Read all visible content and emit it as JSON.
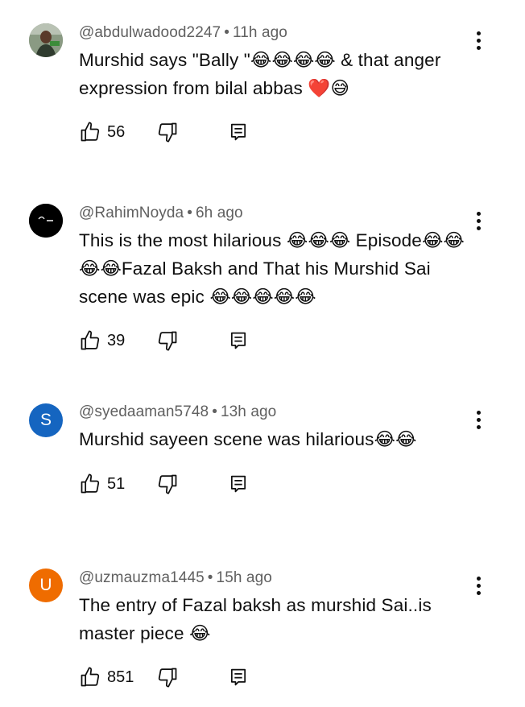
{
  "comments": [
    {
      "handle": "@abdulwadood2247",
      "time": "11h ago",
      "text": "Murshid says \"Bally \"😂😂😂😂 & that anger expression from bilal abbas ❤️😅",
      "likes": "56",
      "avatar": {
        "type": "photo",
        "color": "#6b7f63"
      }
    },
    {
      "handle": "@RahimNoyda",
      "time": "6h ago",
      "text": "This is the most hilarious 😂😂😂 Episode😂😂😂😂Fazal Baksh and That his Murshid Sai scene was epic 😂😂😂😂😂",
      "likes": "39",
      "avatar": {
        "type": "logo",
        "color": "#000000"
      }
    },
    {
      "handle": "@syedaaman5748",
      "time": "13h ago",
      "text": "Murshid sayeen scene was hilarious😂😂",
      "likes": "51",
      "avatar": {
        "type": "letter",
        "letter": "S",
        "color": "#1565c0"
      }
    },
    {
      "handle": "@uzmauzma1445",
      "time": "15h ago",
      "text": "The entry of Fazal baksh as murshid Sai..is master piece 😂",
      "likes": "851",
      "avatar": {
        "type": "letter",
        "letter": "U",
        "color": "#ef6c00"
      }
    }
  ],
  "icons": {
    "like": "thumb-up-outline-icon",
    "dislike": "thumb-down-outline-icon",
    "reply": "reply-comment-icon",
    "menu": "more-vertical-icon"
  }
}
